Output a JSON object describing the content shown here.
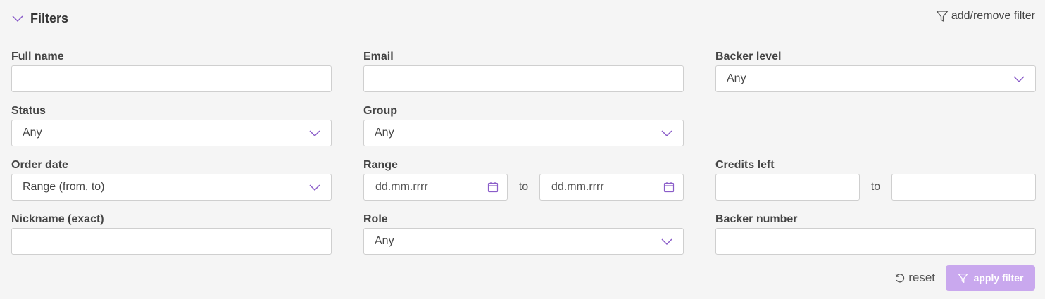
{
  "header": {
    "title": "Filters",
    "add_remove_label": "add/remove filter"
  },
  "fields": {
    "full_name": {
      "label": "Full name",
      "value": ""
    },
    "email": {
      "label": "Email",
      "value": ""
    },
    "backer_level": {
      "label": "Backer level",
      "selected": "Any"
    },
    "status": {
      "label": "Status",
      "selected": "Any"
    },
    "group": {
      "label": "Group",
      "selected": "Any"
    },
    "order_date": {
      "label": "Order date",
      "selected": "Range (from, to)"
    },
    "range": {
      "label": "Range",
      "from_placeholder": "dd.mm.rrrr",
      "to_label": "to",
      "to_placeholder": "dd.mm.rrrr"
    },
    "credits_left": {
      "label": "Credits left",
      "to_label": "to"
    },
    "nickname": {
      "label": "Nickname (exact)",
      "value": ""
    },
    "role": {
      "label": "Role",
      "selected": "Any"
    },
    "backer_number": {
      "label": "Backer number",
      "value": ""
    }
  },
  "footer": {
    "reset_label": "reset",
    "apply_label": "apply filter"
  },
  "colors": {
    "accent": "#8a5cc9",
    "apply_button_bg": "#c9a8ee",
    "background": "#f5f5f5"
  },
  "icons": {
    "collapse": "chevron-down-icon",
    "filter": "funnel-icon",
    "calendar": "calendar-icon",
    "reset": "reset-icon"
  }
}
